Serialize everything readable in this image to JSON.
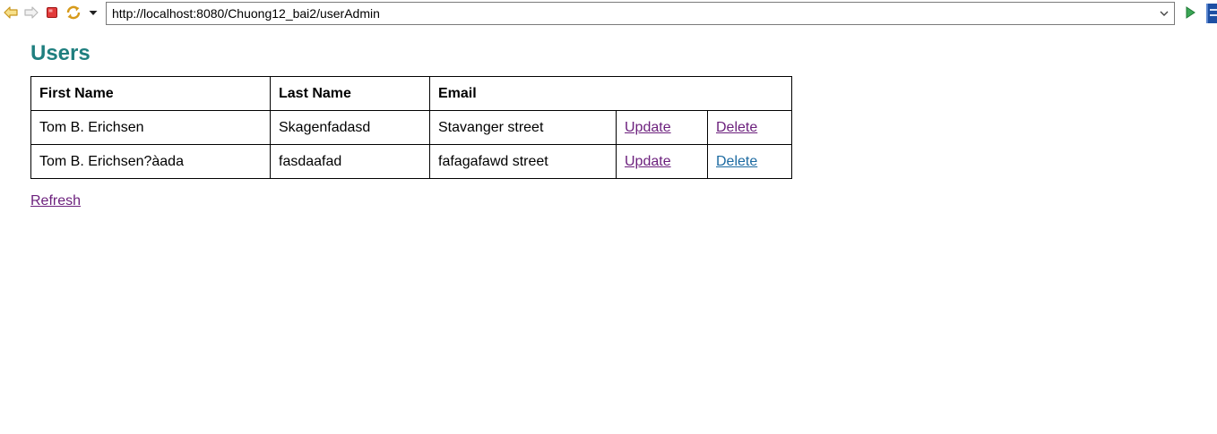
{
  "browser": {
    "url": "http://localhost:8080/Chuong12_bai2/userAdmin"
  },
  "page": {
    "title": "Users",
    "refresh_label": "Refresh"
  },
  "table": {
    "headers": [
      "First Name",
      "Last Name",
      "Email"
    ],
    "rows": [
      {
        "first_name": "Tom B. Erichsen",
        "last_name": "Skagenfadasd",
        "email": "Stavanger street",
        "update_label": "Update",
        "delete_label": "Delete"
      },
      {
        "first_name": "Tom B. Erichsen?àada",
        "last_name": "fasdaafad",
        "email": "fafagafawd street",
        "update_label": "Update",
        "delete_label": "Delete"
      }
    ]
  },
  "colors": {
    "title": "#1f7f7f",
    "visited_link": "#6b1f7c",
    "link": "#1c6aa1"
  },
  "icons": {
    "back": "back-arrow-icon",
    "forward": "forward-arrow-icon",
    "stop": "stop-icon",
    "refresh": "refresh-icon",
    "dropdown": "dropdown-triangle-icon",
    "url_dropdown": "chevron-down-icon",
    "go": "go-play-icon",
    "extension": "extension-icon"
  }
}
